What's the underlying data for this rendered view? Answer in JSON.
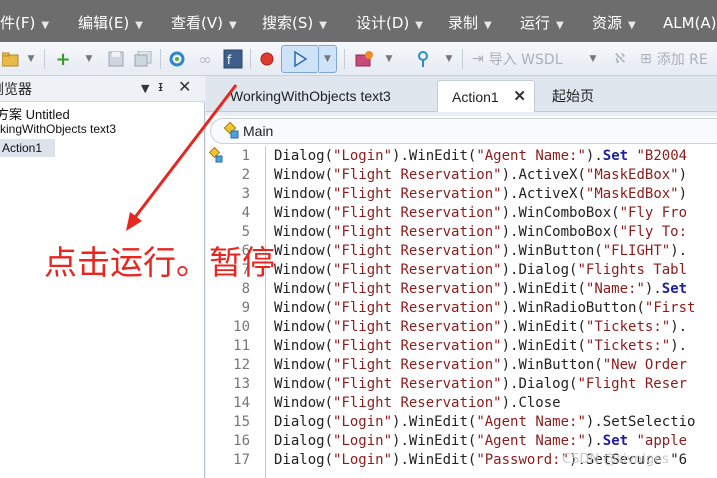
{
  "menu": {
    "items": [
      {
        "label": "件(F)"
      },
      {
        "label": "编辑(E)"
      },
      {
        "label": "查看(V)"
      },
      {
        "label": "搜索(S)"
      },
      {
        "label": "设计(D)"
      },
      {
        "label": "录制"
      },
      {
        "label": "运行"
      },
      {
        "label": "资源"
      },
      {
        "label": "ALM(A)"
      }
    ]
  },
  "toolbar": {
    "import_wsdl_label": "导入 WSDL",
    "add_label": "添加 RE"
  },
  "left_panel": {
    "title": "浏览器",
    "tree": {
      "solution": "方案 Untitled",
      "test": "rkingWithObjects text3",
      "action": "Action1"
    }
  },
  "tabs": [
    {
      "label": "WorkingWithObjects text3"
    },
    {
      "label": "Action1"
    },
    {
      "label": "起始页"
    }
  ],
  "breadcrumb": {
    "label": "Main"
  },
  "code": {
    "line_numbers": [
      "1",
      "2",
      "3",
      "4",
      "5",
      "6",
      "7",
      "8",
      "9",
      "10",
      "11",
      "12",
      "13",
      "14",
      "15",
      "16",
      "17"
    ],
    "lines": [
      [
        {
          "t": "Dialog(",
          "c": ""
        },
        {
          "t": "\"Login\"",
          "c": "str"
        },
        {
          "t": ").WinEdit(",
          "c": ""
        },
        {
          "t": "\"Agent Name:\"",
          "c": "str"
        },
        {
          "t": ").",
          "c": ""
        },
        {
          "t": "Set",
          "c": "kw"
        },
        {
          "t": " \"B2004",
          "c": "str"
        }
      ],
      [
        {
          "t": "Window(",
          "c": ""
        },
        {
          "t": "\"Flight Reservation\"",
          "c": "str"
        },
        {
          "t": ").ActiveX(",
          "c": ""
        },
        {
          "t": "\"MaskEdBox\"",
          "c": "str"
        },
        {
          "t": ")",
          "c": ""
        }
      ],
      [
        {
          "t": "Window(",
          "c": ""
        },
        {
          "t": "\"Flight Reservation\"",
          "c": "str"
        },
        {
          "t": ").ActiveX(",
          "c": ""
        },
        {
          "t": "\"MaskEdBox\"",
          "c": "str"
        },
        {
          "t": ")",
          "c": ""
        }
      ],
      [
        {
          "t": "Window(",
          "c": ""
        },
        {
          "t": "\"Flight Reservation\"",
          "c": "str"
        },
        {
          "t": ").WinComboBox(",
          "c": ""
        },
        {
          "t": "\"Fly Fro",
          "c": "str"
        }
      ],
      [
        {
          "t": "Window(",
          "c": ""
        },
        {
          "t": "\"Flight Reservation\"",
          "c": "str"
        },
        {
          "t": ").WinComboBox(",
          "c": ""
        },
        {
          "t": "\"Fly To:",
          "c": "str"
        }
      ],
      [
        {
          "t": "Window(",
          "c": ""
        },
        {
          "t": "\"Flight Reservation\"",
          "c": "str"
        },
        {
          "t": ").WinButton(",
          "c": ""
        },
        {
          "t": "\"FLIGHT\"",
          "c": "str"
        },
        {
          "t": ").",
          "c": ""
        }
      ],
      [
        {
          "t": "Window(",
          "c": ""
        },
        {
          "t": "\"Flight Reservation\"",
          "c": "str"
        },
        {
          "t": ").Dialog(",
          "c": ""
        },
        {
          "t": "\"Flights Tabl",
          "c": "str"
        }
      ],
      [
        {
          "t": "Window(",
          "c": ""
        },
        {
          "t": "\"Flight Reservation\"",
          "c": "str"
        },
        {
          "t": ").WinEdit(",
          "c": ""
        },
        {
          "t": "\"Name:\"",
          "c": "str"
        },
        {
          "t": ").",
          "c": ""
        },
        {
          "t": "Set",
          "c": "kw"
        }
      ],
      [
        {
          "t": "Window(",
          "c": ""
        },
        {
          "t": "\"Flight Reservation\"",
          "c": "str"
        },
        {
          "t": ").WinRadioButton(",
          "c": ""
        },
        {
          "t": "\"First",
          "c": "str"
        }
      ],
      [
        {
          "t": "Window(",
          "c": ""
        },
        {
          "t": "\"Flight Reservation\"",
          "c": "str"
        },
        {
          "t": ").WinEdit(",
          "c": ""
        },
        {
          "t": "\"Tickets:\"",
          "c": "str"
        },
        {
          "t": ").",
          "c": ""
        }
      ],
      [
        {
          "t": "Window(",
          "c": ""
        },
        {
          "t": "\"Flight Reservation\"",
          "c": "str"
        },
        {
          "t": ").WinEdit(",
          "c": ""
        },
        {
          "t": "\"Tickets:\"",
          "c": "str"
        },
        {
          "t": ").",
          "c": ""
        }
      ],
      [
        {
          "t": "Window(",
          "c": ""
        },
        {
          "t": "\"Flight Reservation\"",
          "c": "str"
        },
        {
          "t": ").WinButton(",
          "c": ""
        },
        {
          "t": "\"New Order",
          "c": "str"
        }
      ],
      [
        {
          "t": "Window(",
          "c": ""
        },
        {
          "t": "\"Flight Reservation\"",
          "c": "str"
        },
        {
          "t": ").Dialog(",
          "c": ""
        },
        {
          "t": "\"Flight Reser",
          "c": "str"
        }
      ],
      [
        {
          "t": "Window(",
          "c": ""
        },
        {
          "t": "\"Flight Reservation\"",
          "c": "str"
        },
        {
          "t": ").Close",
          "c": ""
        }
      ],
      [
        {
          "t": "Dialog(",
          "c": ""
        },
        {
          "t": "\"Login\"",
          "c": "str"
        },
        {
          "t": ").WinEdit(",
          "c": ""
        },
        {
          "t": "\"Agent Name:\"",
          "c": "str"
        },
        {
          "t": ").SetSelectio",
          "c": ""
        }
      ],
      [
        {
          "t": "Dialog(",
          "c": ""
        },
        {
          "t": "\"Login\"",
          "c": "str"
        },
        {
          "t": ").WinEdit(",
          "c": ""
        },
        {
          "t": "\"Agent Name:\"",
          "c": "str"
        },
        {
          "t": ").",
          "c": ""
        },
        {
          "t": "Set",
          "c": "kw"
        },
        {
          "t": " \"apple",
          "c": "str"
        }
      ],
      [
        {
          "t": "Dialog(",
          "c": ""
        },
        {
          "t": "\"Login\"",
          "c": "str"
        },
        {
          "t": ").WinEdit(",
          "c": ""
        },
        {
          "t": "\"Password:\"",
          "c": "str"
        },
        {
          "t": ").SetSecure \"6",
          "c": ""
        }
      ]
    ]
  },
  "annotation": {
    "text": "点击运行。暂停",
    "color": "#e6261f"
  },
  "watermark": {
    "text": "CSDN @sivolges"
  },
  "colors": {
    "menubar": "#6d6d6d",
    "annotation": "#e6261f",
    "string": "#8b1c1c",
    "keyword": "#1f1f9c"
  }
}
